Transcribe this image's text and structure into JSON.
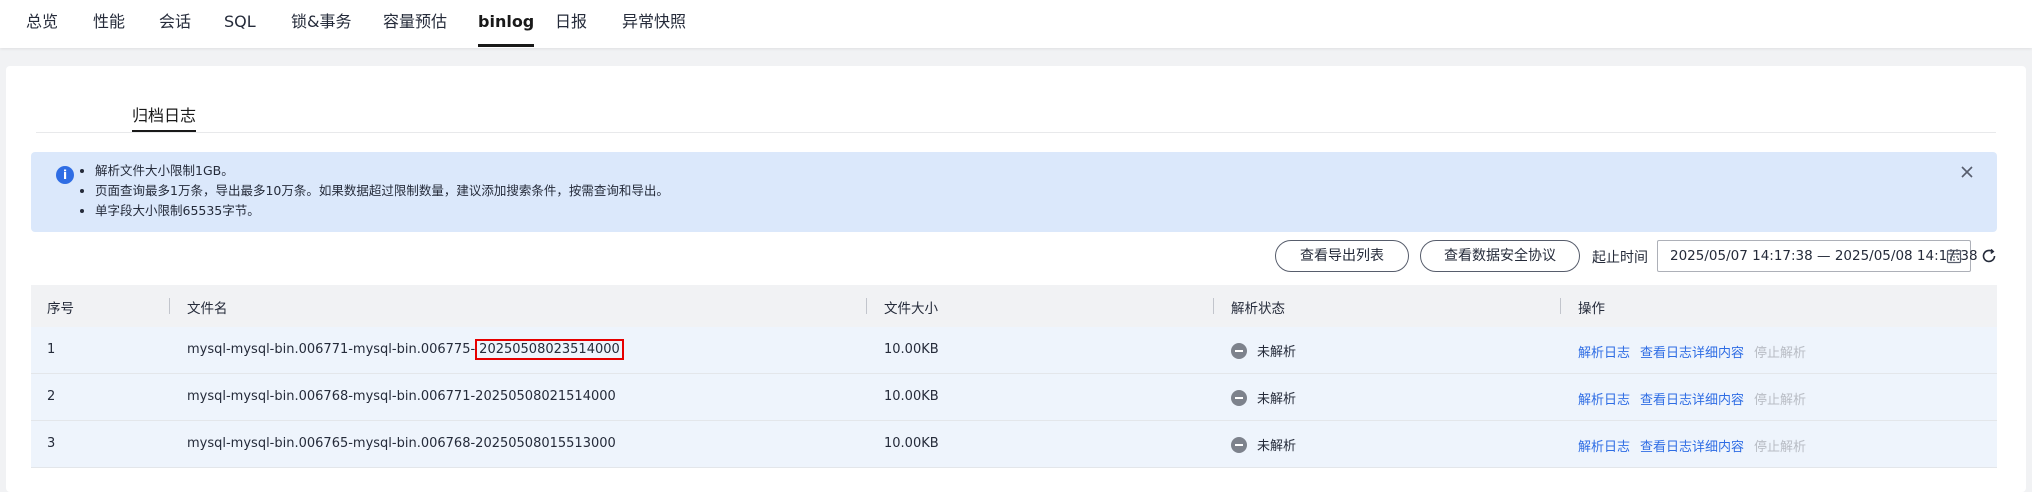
{
  "nav": {
    "tabs": [
      "总览",
      "性能",
      "会话",
      "SQL",
      "锁&事务",
      "容量预估",
      "binlog",
      "日报",
      "异常快照"
    ],
    "active": "binlog"
  },
  "subtab": {
    "label": "归档日志"
  },
  "alert": {
    "items": [
      "解析文件大小限制1GB。",
      "页面查询最多1万条，导出最多10万条。如果数据超过限制数量，建议添加搜索条件，按需查询和导出。",
      "单字段大小限制65535字节。"
    ]
  },
  "toolbar": {
    "export_list": "查看导出列表",
    "security_protocol": "查看数据安全协议",
    "range_label": "起止时间",
    "range_value": "2025/05/07 14:17:38 — 2025/05/08 14:17:38"
  },
  "table": {
    "headers": [
      "序号",
      "文件名",
      "文件大小",
      "解析状态",
      "操作"
    ],
    "rows": [
      {
        "no": "1",
        "name_prefix": "mysql-mysql-bin.006771-mysql-bin.006775-",
        "name_suffix": "20250508023514000",
        "size": "10.00KB",
        "status": "未解析"
      },
      {
        "no": "2",
        "name_prefix": "mysql-mysql-bin.006768-mysql-bin.006771-",
        "name_suffix": "20250508021514000",
        "size": "10.00KB",
        "status": "未解析"
      },
      {
        "no": "3",
        "name_prefix": "mysql-mysql-bin.006765-mysql-bin.006768-",
        "name_suffix": "20250508015513000",
        "size": "10.00KB",
        "status": "未解析"
      }
    ],
    "actions": [
      "解析日志",
      "查看日志详细内容",
      "停止解析"
    ]
  },
  "colors": {
    "accent": "#2f6de4",
    "highlight": "#e60000",
    "alert_bg": "#dbe8fb"
  }
}
